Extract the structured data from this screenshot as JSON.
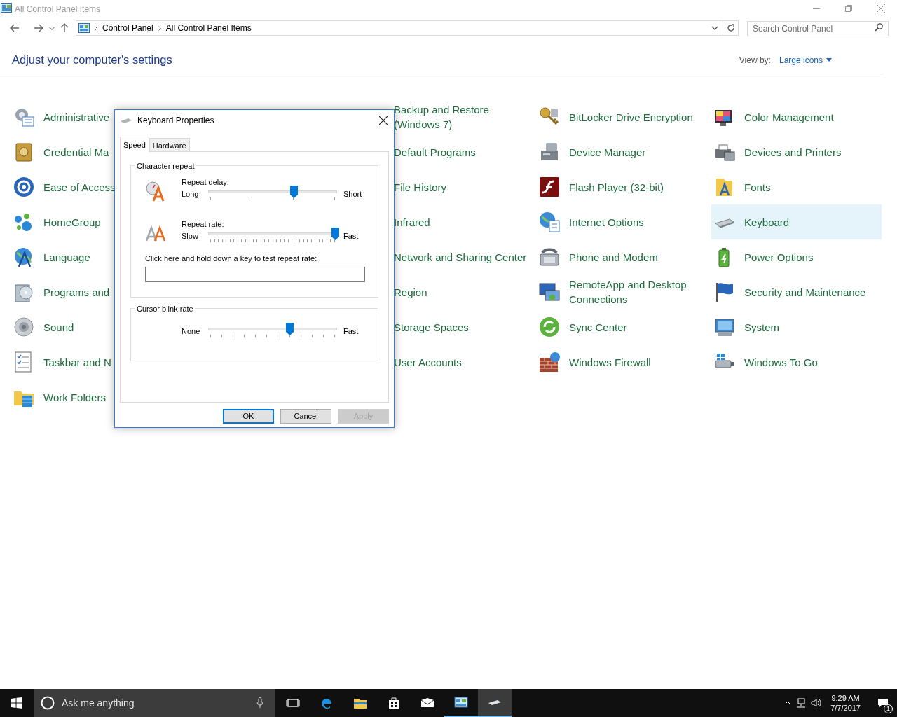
{
  "window": {
    "title": "All Control Panel Items"
  },
  "address_bar": {
    "crumbs": [
      "Control Panel",
      "All Control Panel Items"
    ]
  },
  "search": {
    "placeholder": "Search Control Panel"
  },
  "heading": "Adjust your computer's settings",
  "view_by": {
    "label": "View by:",
    "value": "Large icons"
  },
  "columns": [
    {
      "items": [
        {
          "label": "Administrative",
          "selected": false
        },
        {
          "label": "Credential Ma",
          "selected": false
        },
        {
          "label": "Ease of Access",
          "selected": false
        },
        {
          "label": "HomeGroup",
          "selected": false
        },
        {
          "label": "Language",
          "selected": false
        },
        {
          "label": "Programs and",
          "selected": false
        },
        {
          "label": "Sound",
          "selected": false
        },
        {
          "label": "Taskbar and N",
          "selected": false
        },
        {
          "label": "Work Folders",
          "selected": false
        }
      ]
    },
    {
      "items": [
        {
          "label": "Backup and Restore (Windows 7)",
          "selected": false
        },
        {
          "label": "Default Programs",
          "selected": false
        },
        {
          "label": "File History",
          "selected": false
        },
        {
          "label": "Infrared",
          "selected": false
        },
        {
          "label": "Network and Sharing Center",
          "selected": false
        },
        {
          "label": "Region",
          "selected": false
        },
        {
          "label": "Storage Spaces",
          "selected": false
        },
        {
          "label": "User Accounts",
          "selected": false
        }
      ]
    },
    {
      "items": [
        {
          "label": "BitLocker Drive Encryption",
          "selected": false
        },
        {
          "label": "Device Manager",
          "selected": false
        },
        {
          "label": "Flash Player (32-bit)",
          "selected": false
        },
        {
          "label": "Internet Options",
          "selected": false
        },
        {
          "label": "Phone and Modem",
          "selected": false
        },
        {
          "label": "RemoteApp and Desktop Connections",
          "selected": false
        },
        {
          "label": "Sync Center",
          "selected": false
        },
        {
          "label": "Windows Firewall",
          "selected": false
        }
      ]
    },
    {
      "items": [
        {
          "label": "Color Management",
          "selected": false
        },
        {
          "label": "Devices and Printers",
          "selected": false
        },
        {
          "label": "Fonts",
          "selected": false
        },
        {
          "label": "Keyboard",
          "selected": true
        },
        {
          "label": "Power Options",
          "selected": false
        },
        {
          "label": "Security and Maintenance",
          "selected": false
        },
        {
          "label": "System",
          "selected": false
        },
        {
          "label": "Windows To Go",
          "selected": false
        }
      ]
    }
  ],
  "dialog": {
    "title": "Keyboard Properties",
    "tabs": [
      {
        "label": "Speed",
        "selected": true
      },
      {
        "label": "Hardware",
        "selected": false
      }
    ],
    "groups": [
      {
        "title": "Character repeat",
        "sliders": [
          {
            "label": "Repeat delay:",
            "left": "Long",
            "right": "Short",
            "level": 0.667
          },
          {
            "label": "Repeat rate:",
            "left": "Slow",
            "right": "Fast",
            "level": 1
          }
        ],
        "test_field": {
          "label": "Click here and hold down a key to test repeat rate:"
        }
      },
      {
        "title": "Cursor blink rate",
        "sliders": [
          {
            "left": "None",
            "right": "Fast",
            "level": 0.636
          }
        ]
      }
    ],
    "buttons": [
      {
        "label": "OK",
        "default": true,
        "disabled": false
      },
      {
        "label": "Cancel",
        "default": false,
        "disabled": false
      },
      {
        "label": "Apply",
        "default": false,
        "disabled": true
      }
    ]
  },
  "taskbar": {
    "search": {
      "placeholder": "Ask me anything"
    },
    "apps": [
      {
        "running": false,
        "selected": false
      },
      {
        "running": false,
        "selected": false
      },
      {
        "running": false,
        "selected": false
      },
      {
        "running": false,
        "selected": false
      },
      {
        "running": false,
        "selected": false
      },
      {
        "running": true,
        "selected": false
      },
      {
        "running": true,
        "selected": true
      }
    ],
    "time": "9:29 AM",
    "date": "7/7/2017",
    "notifications": "1"
  }
}
